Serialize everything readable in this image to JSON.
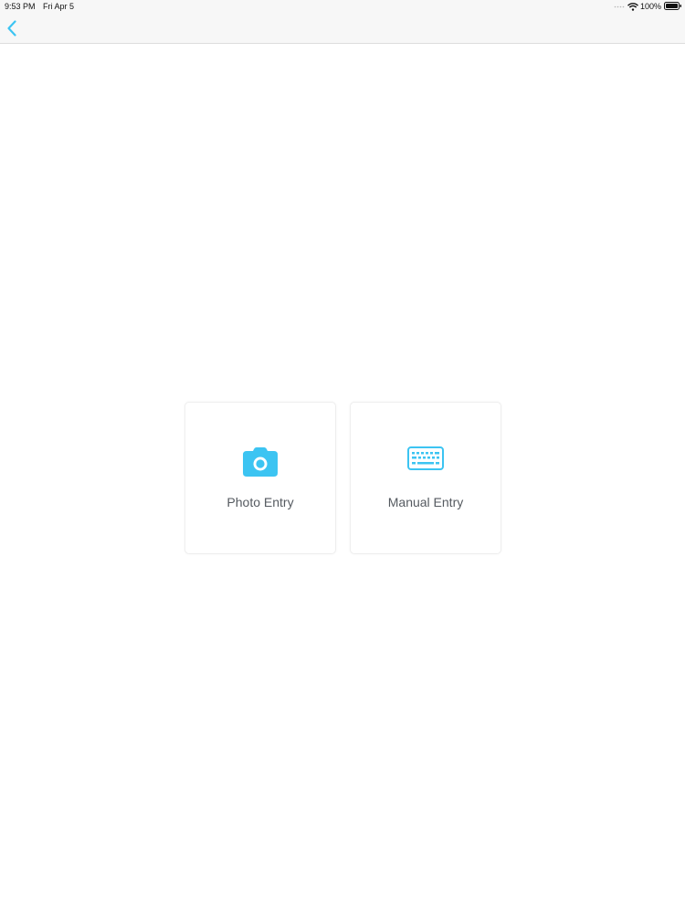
{
  "status_bar": {
    "time": "9:53 PM",
    "date": "Fri Apr 5",
    "battery": "100%"
  },
  "nav": {
    "back_icon": "chevron-left-icon"
  },
  "options": [
    {
      "label": "Photo Entry",
      "icon": "camera-icon"
    },
    {
      "label": "Manual Entry",
      "icon": "keyboard-icon"
    }
  ],
  "colors": {
    "accent": "#3cc4f2",
    "label": "#555a60",
    "nav_bar": "#f7f7f7"
  }
}
